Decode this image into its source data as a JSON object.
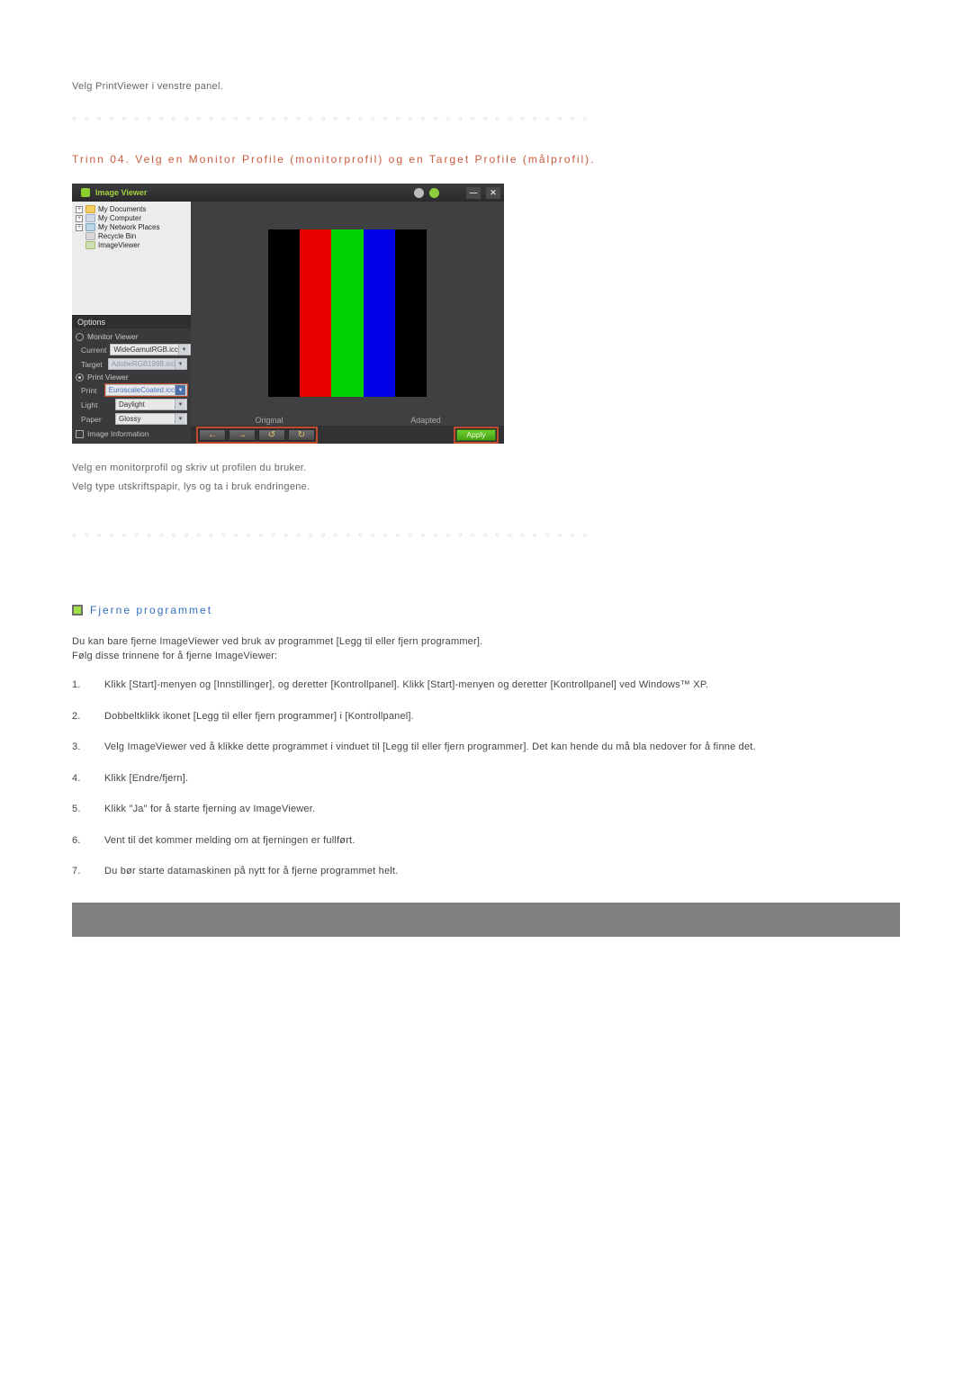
{
  "intro": "Velg PrintViewer i venstre panel.",
  "step_heading": "Trinn 04. Velg en Monitor Profile (monitorprofil) og en Target Profile (målprofil).",
  "app": {
    "title": "Image Viewer",
    "tree": {
      "items": [
        "My Documents",
        "My Computer",
        "My Network Places",
        "Recycle Bin",
        "ImageViewer"
      ]
    },
    "options_label": "Options",
    "monitor_radio": "Monitor Viewer",
    "print_radio": "Print Viewer",
    "rows": {
      "current": {
        "label": "Current",
        "value": "WideGamutRGB.icc"
      },
      "target": {
        "label": "Target",
        "value": "AdobeRGB1998.icc"
      },
      "print": {
        "label": "Print",
        "value": "EuroscaleCoated.icc"
      },
      "light": {
        "label": "Light",
        "value": "Daylight"
      },
      "paper": {
        "label": "Paper",
        "value": "Glossy"
      }
    },
    "image_info": "Image Information",
    "labels": {
      "original": "Original",
      "adapted": "Adapted"
    },
    "apply": "Apply"
  },
  "under": {
    "line1": "Velg en monitorprofil og skriv ut profilen du bruker.",
    "line2": "Velg type utskriftspapir, lys og ta i bruk endringene."
  },
  "section2": {
    "title": "Fjerne programmet",
    "p1": "Du kan bare fjerne ImageViewer ved bruk av programmet [Legg til eller fjern programmer].",
    "p2": "Følg disse trinnene for å fjerne ImageViewer:",
    "steps": [
      "Klikk [Start]-menyen og [Innstillinger], og deretter [Kontrollpanel]. Klikk [Start]-menyen og deretter [Kontrollpanel] ved Windows™ XP.",
      "Dobbeltklikk ikonet [Legg til eller fjern programmer] i [Kontrollpanel].",
      "Velg ImageViewer ved å klikke dette programmet i vinduet til [Legg til eller fjern programmer]. Det kan hende du må bla nedover for å finne det.",
      "Klikk [Endre/fjern].",
      "Klikk \"Ja\" for å starte fjerning av ImageViewer.",
      "Vent til det kommer melding om at fjerningen er fullført.",
      "Du bør starte datamaskinen på nytt for å fjerne programmet helt."
    ]
  }
}
